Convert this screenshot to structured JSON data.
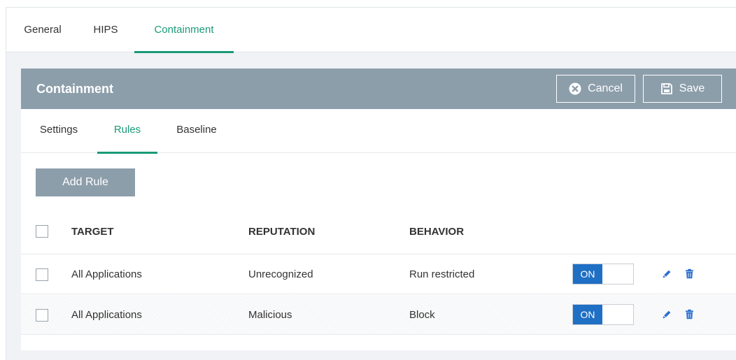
{
  "top_tabs": [
    {
      "label": "General"
    },
    {
      "label": "HIPS"
    },
    {
      "label": "Containment"
    }
  ],
  "active_top_tab": "Containment",
  "panel": {
    "title": "Containment",
    "cancel_label": "Cancel",
    "save_label": "Save"
  },
  "sub_tabs": [
    {
      "label": "Settings"
    },
    {
      "label": "Rules"
    },
    {
      "label": "Baseline"
    }
  ],
  "active_sub_tab": "Rules",
  "add_rule_label": "Add Rule",
  "table": {
    "columns": [
      "TARGET",
      "REPUTATION",
      "BEHAVIOR"
    ],
    "rows": [
      {
        "target": "All Applications",
        "reputation": "Unrecognized",
        "behavior": "Run restricted",
        "toggle": "ON"
      },
      {
        "target": "All Applications",
        "reputation": "Malicious",
        "behavior": "Block",
        "toggle": "ON"
      }
    ]
  },
  "icons": [
    "times-circle-icon",
    "floppy-disk-icon",
    "pencil-icon",
    "trash-icon"
  ],
  "colors": {
    "accent": "#1a9a78",
    "header_bg": "#8d9eab",
    "toggle_on": "#1f6fc4",
    "action_icon": "#2a6fcf"
  }
}
